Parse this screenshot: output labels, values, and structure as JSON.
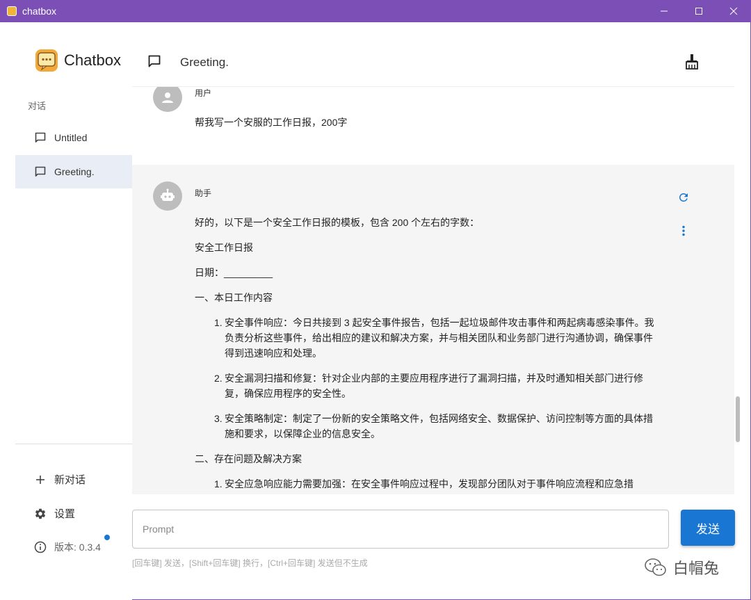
{
  "window": {
    "title": "chatbox"
  },
  "sidebar": {
    "brand": "Chatbox",
    "section_label": "对话",
    "conversations": [
      {
        "label": "Untitled",
        "active": false
      },
      {
        "label": "Greeting.",
        "active": true
      }
    ],
    "new_chat": "新对话",
    "settings": "设置",
    "version": "版本: 0.3.4"
  },
  "header": {
    "title": "Greeting."
  },
  "messages": {
    "user": {
      "role": "用户",
      "text": "帮我写一个安服的工作日报，200字"
    },
    "assistant": {
      "role": "助手",
      "intro": "好的，以下是一个安全工作日报的模板，包含 200 个左右的字数：",
      "report_title": "安全工作日报",
      "date_line": "日期：_________",
      "section1": "一、本日工作内容",
      "items1": [
        "安全事件响应：今日共接到 3 起安全事件报告，包括一起垃圾邮件攻击事件和两起病毒感染事件。我负责分析这些事件，给出相应的建议和解决方案，并与相关团队和业务部门进行沟通协调，确保事件得到迅速响应和处理。",
        "安全漏洞扫描和修复：针对企业内部的主要应用程序进行了漏洞扫描，并及时通知相关部门进行修复，确保应用程序的安全性。",
        "安全策略制定：制定了一份新的安全策略文件，包括网络安全、数据保护、访问控制等方面的具体措施和要求，以保障企业的信息安全。"
      ],
      "section2": "二、存在问题及解决方案",
      "items2": [
        "安全应急响应能力需要加强：在安全事件响应过程中，发现部分团队对于事件响应流程和应急措"
      ]
    }
  },
  "input": {
    "placeholder": "Prompt",
    "send_label": "发送",
    "hint": "[回车键] 发送，[Shift+回车键] 换行，[Ctrl+回车键] 发送但不生成"
  },
  "watermark": {
    "text": "白帽兔"
  },
  "colors": {
    "titlebar": "#7b4fb6",
    "accent": "#1976d2",
    "active_item": "#e9eef6",
    "assistant_bg": "#f5f5f5"
  }
}
